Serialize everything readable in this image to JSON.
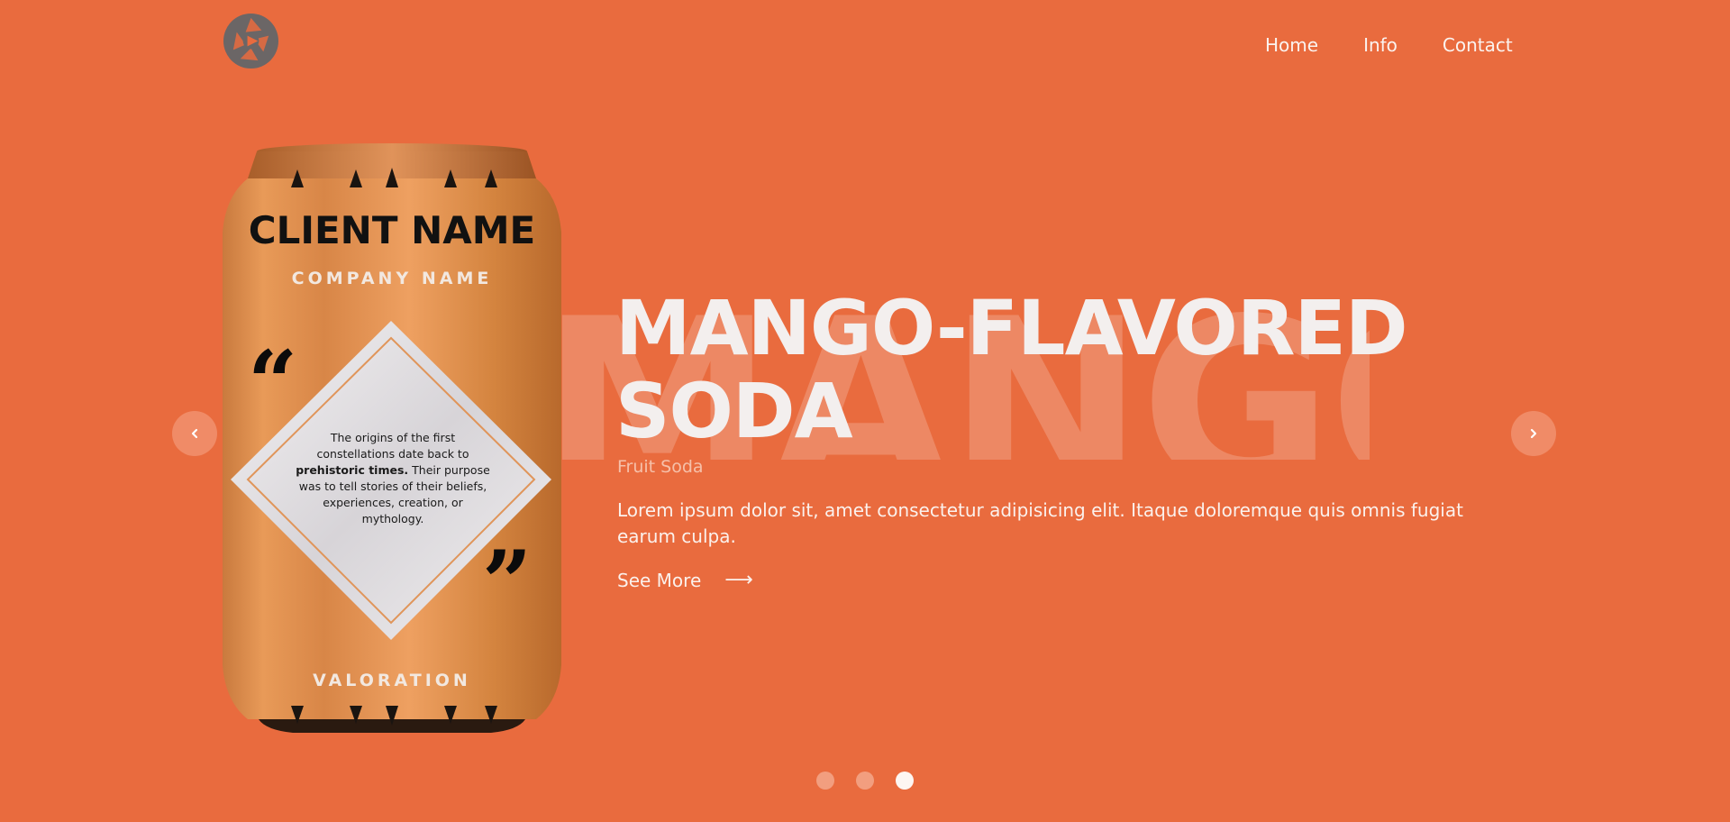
{
  "nav": {
    "items": [
      {
        "label": "Home"
      },
      {
        "label": "Info"
      },
      {
        "label": "Contact"
      }
    ]
  },
  "hero": {
    "background_word": "MANGO",
    "title_line1": "MANGO-FLAVORED",
    "title_line2": "SODA",
    "subtitle": "Fruit Soda",
    "description": "Lorem ipsum dolor sit, amet consectetur adipisicing elit. Itaque doloremque quis omnis fugiat earum culpa.",
    "see_more_label": "See More",
    "see_more_arrow": "⟶"
  },
  "can": {
    "client_name": "CLIENT NAME",
    "company_name": "COMPANY NAME",
    "quote_line1": "The origins of the first",
    "quote_line2": "constellations date back to",
    "quote_bold": "prehistoric times.",
    "quote_line3": "Their purpose",
    "quote_line4": "was to tell stories of their beliefs,",
    "quote_line5": "experiences, creation, or",
    "quote_line6": "mythology.",
    "bottom_label": "VALORATION"
  },
  "slider": {
    "prev_icon": "chevron-left-icon",
    "next_icon": "chevron-right-icon",
    "dots_count": 3,
    "active_index": 2
  },
  "colors": {
    "background": "#e96b3e",
    "can_body": "#e5904f",
    "logo": "#6e6a6a"
  }
}
